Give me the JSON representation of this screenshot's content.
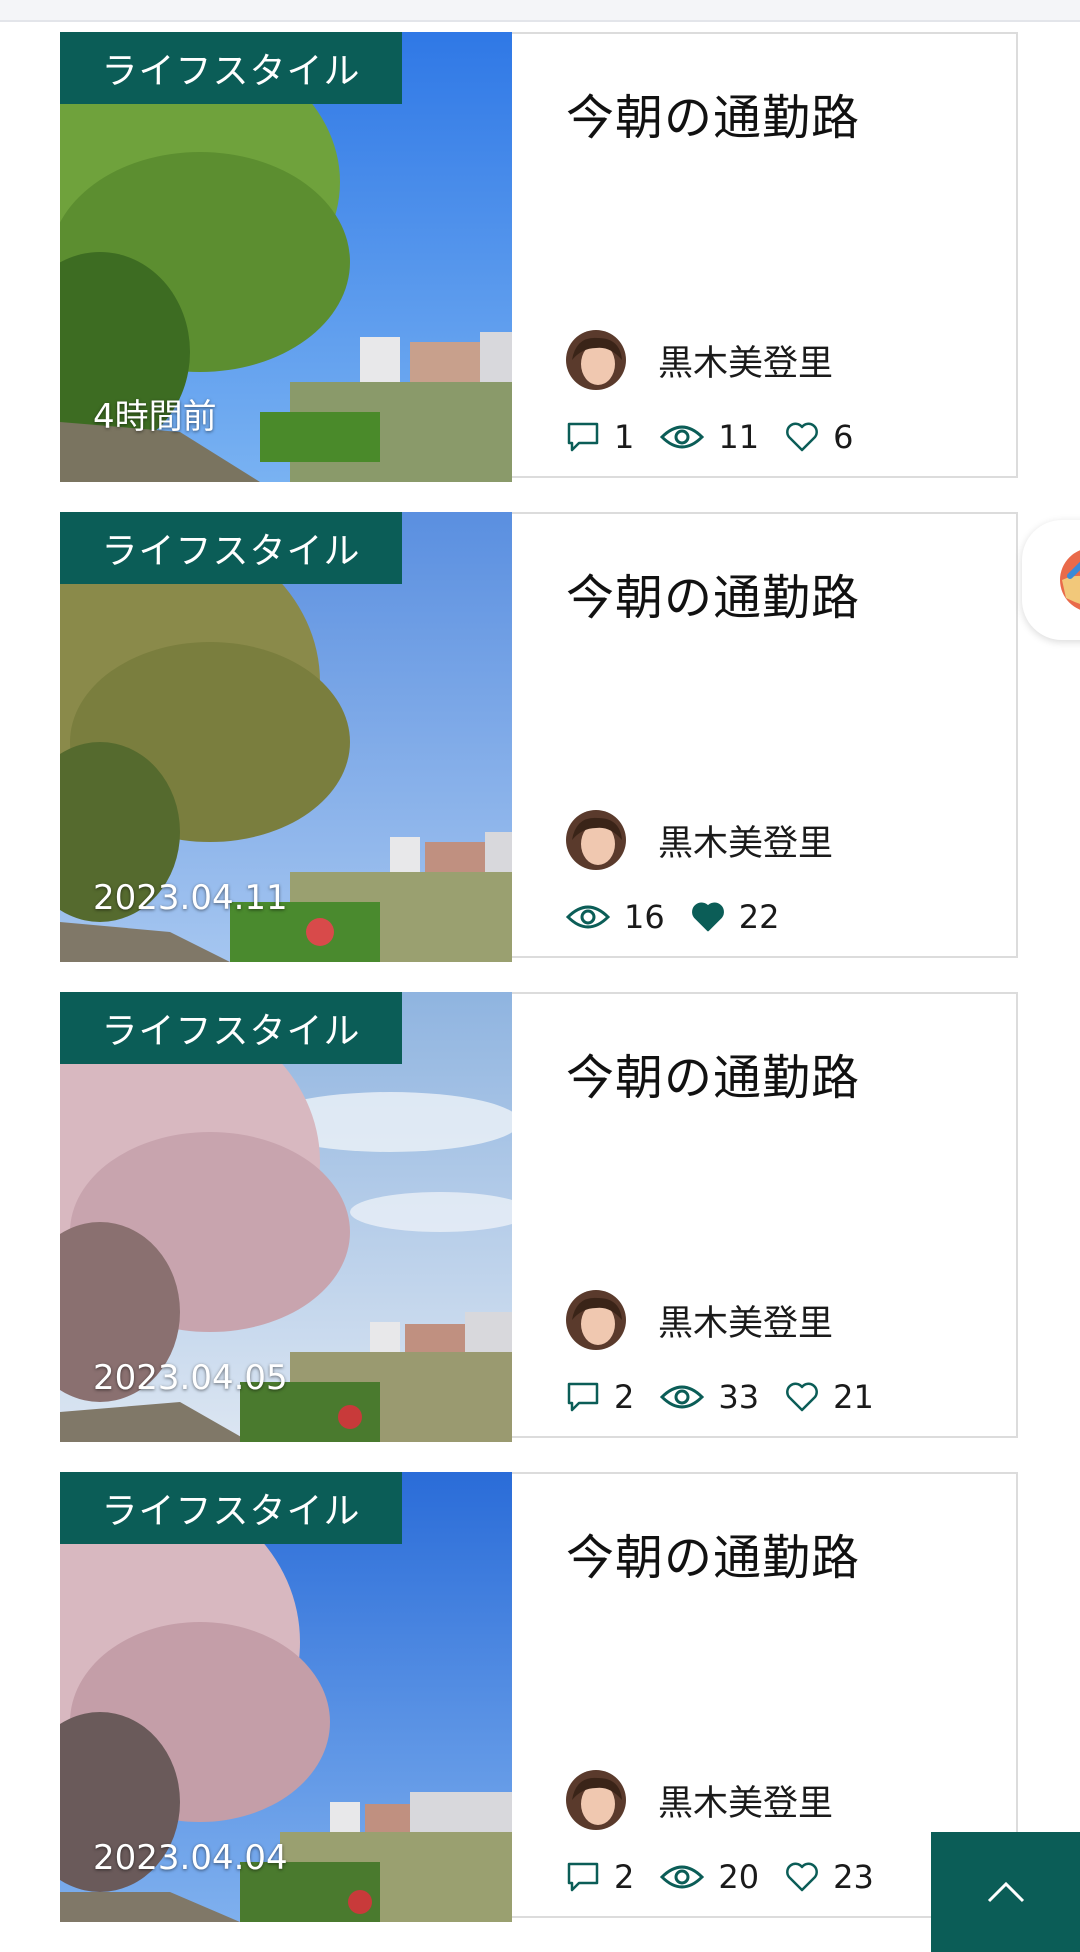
{
  "posts": [
    {
      "category": "ライフスタイル",
      "time": "4時間前",
      "title": "今朝の通勤路",
      "author": "黒木美登里",
      "comments": "1",
      "views": "11",
      "likes": "6"
    },
    {
      "category": "ライフスタイル",
      "time": "2023.04.11",
      "title": "今朝の通勤路",
      "author": "黒木美登里",
      "views": "16",
      "likes": "22"
    },
    {
      "category": "ライフスタイル",
      "time": "2023.04.05",
      "title": "今朝の通勤路",
      "author": "黒木美登里",
      "comments": "2",
      "views": "33",
      "likes": "21"
    },
    {
      "category": "ライフスタイル",
      "time": "2023.04.04",
      "title": "今朝の通勤路",
      "author": "黒木美登里",
      "comments": "2",
      "views": "20",
      "likes": "23"
    }
  ],
  "icons": {
    "comment": "comment-icon",
    "views": "eye-icon",
    "like": "heart-icon",
    "back_to_top": "chevron-up-icon"
  },
  "colors": {
    "accent": "#0b5d57",
    "border": "#dcdcdc"
  }
}
